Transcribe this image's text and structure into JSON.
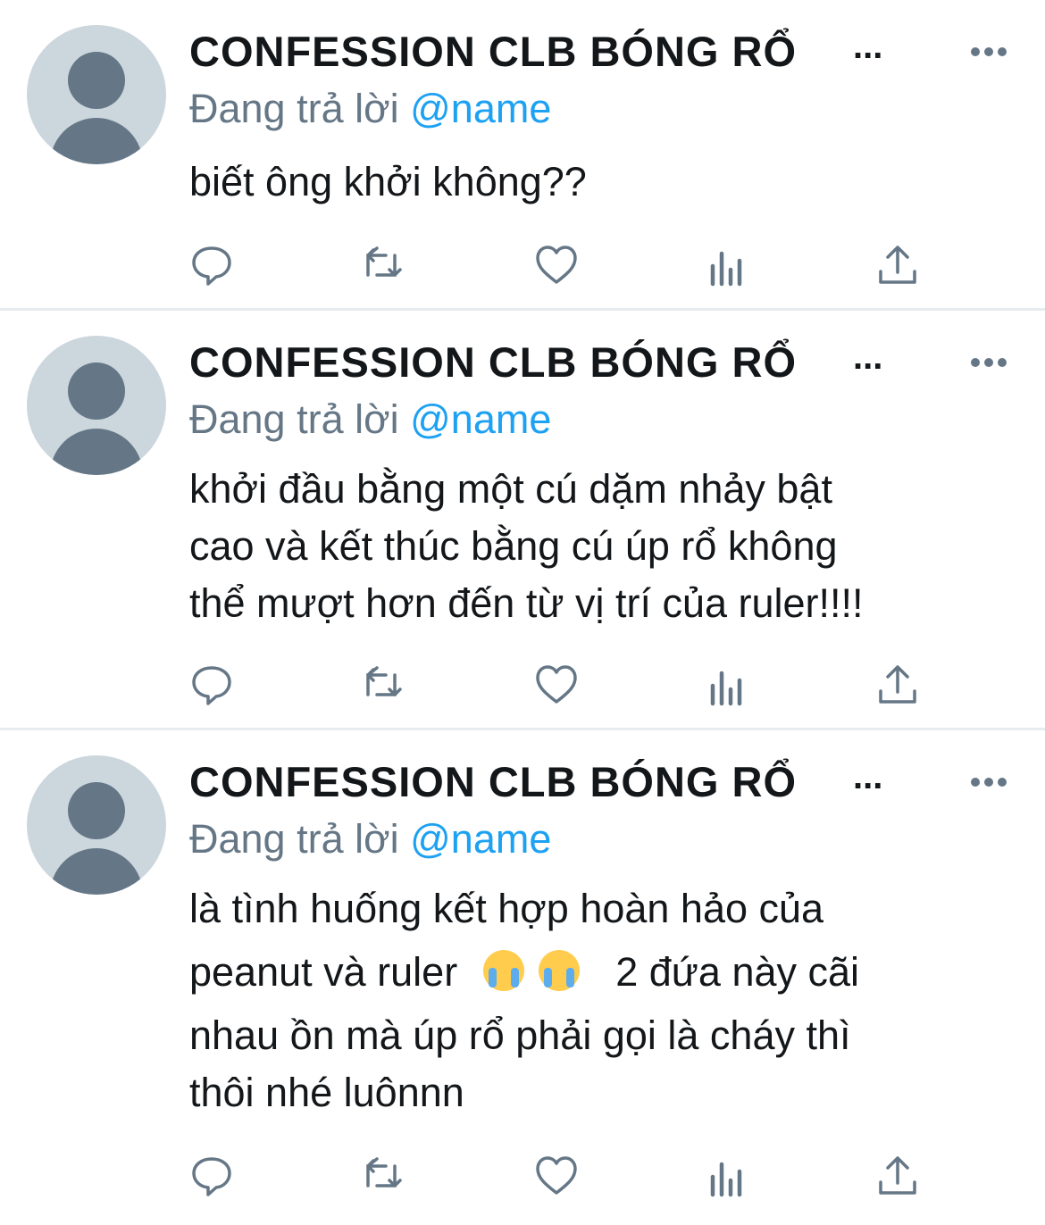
{
  "tweets": [
    {
      "author": "CONFESSION CLB BÓNG RỔ",
      "ellipsis": "...",
      "reply_prefix": "Đang trả lời",
      "reply_handle": "@name",
      "text_lines": [
        "biết ông khởi không??"
      ]
    },
    {
      "author": "CONFESSION CLB BÓNG RỔ",
      "ellipsis": "...",
      "reply_prefix": "Đang trả lời",
      "reply_handle": "@name",
      "text_lines": [
        "khởi đầu bằng một cú dặm nhảy bật",
        "cao và kết thúc bằng cú úp rổ không",
        "thể mượt hơn đến từ vị trí của ruler!!!!"
      ]
    },
    {
      "author": "CONFESSION CLB BÓNG RỔ",
      "ellipsis": "...",
      "reply_prefix": "Đang trả lời",
      "reply_handle": "@name",
      "text_lines": [
        "là tình huống kết hợp hoàn hảo của",
        "peanut và ruler",
        "2 đứa này cãi",
        "nhau ồn mà úp rổ phải gọi là cháy thì",
        "thôi nhé luônnn"
      ],
      "emoji": [
        "crying-face",
        "crying-face"
      ]
    }
  ],
  "icons": [
    "reply-icon",
    "retweet-icon",
    "like-icon",
    "analytics-icon",
    "share-icon",
    "more-icon",
    "avatar-placeholder"
  ],
  "colors": {
    "text": "#14171a",
    "secondary": "#657786",
    "accent": "#1da1f2",
    "divider": "#e6ecf0",
    "avatar_bg": "#ccd6dd"
  }
}
